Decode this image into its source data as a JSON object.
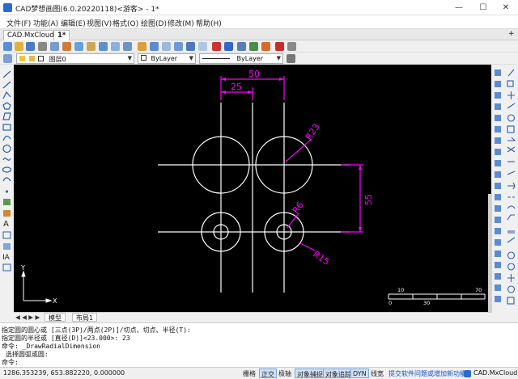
{
  "window": {
    "title": "CAD梦想画图(6.0.20220118)<游客> - 1*",
    "minimize": "—",
    "maximize": "☐",
    "close": "✕"
  },
  "menu": [
    "文件(F)",
    "功能(A)",
    "编辑(E)",
    "视图(V)",
    "格式(O)",
    "绘图(D)",
    "修改(M)",
    "帮助(H)"
  ],
  "tabs": {
    "cloud": "CAD.MxCloud",
    "doc": "1*",
    "add": "+"
  },
  "toolbar2": {
    "layer_value": "图层0",
    "color_value": "ByLayer",
    "linetype_value": "ByLayer"
  },
  "drawing": {
    "dims": {
      "d50": "50",
      "d25": "25",
      "r23": "R23",
      "d55": "55",
      "r6": "R6",
      "r15": "R15"
    },
    "ucs": {
      "x": "X",
      "y": "Y"
    },
    "scalebar": {
      "t10": "10",
      "t70": "70",
      "b0": "0",
      "b30": "30"
    },
    "colors": {
      "geometry": "#ffffff",
      "dimension": "#ff00ff",
      "background": "#000000"
    }
  },
  "layout_tabs": {
    "nav": "◀ ◀ ▶ ▶",
    "model": "模型",
    "layout1": "布局1"
  },
  "command": {
    "lines": [
      "指定圆的圆心或 [三点(3P)/两点(2P)]/切点、切点、半径(T):",
      "指定圆的半径或 [直径(D)]<23.000>: 23",
      "命令: _DrawRadialDimension",
      " 选择圆弧或圆:",
      "命令:"
    ]
  },
  "status": {
    "coords": "1286.353239,  653.882220,  0.000000",
    "buttons": [
      {
        "label": "栅格",
        "on": false
      },
      {
        "label": "正交",
        "on": true
      },
      {
        "label": "极轴",
        "on": false
      },
      {
        "label": "对象捕捉",
        "on": true
      },
      {
        "label": "对象追踪",
        "on": true
      },
      {
        "label": "DYN",
        "on": true
      },
      {
        "label": "线宽",
        "on": false
      }
    ],
    "link": "提交软件问题或增加新功能",
    "brand": "CAD.MxCloud"
  }
}
